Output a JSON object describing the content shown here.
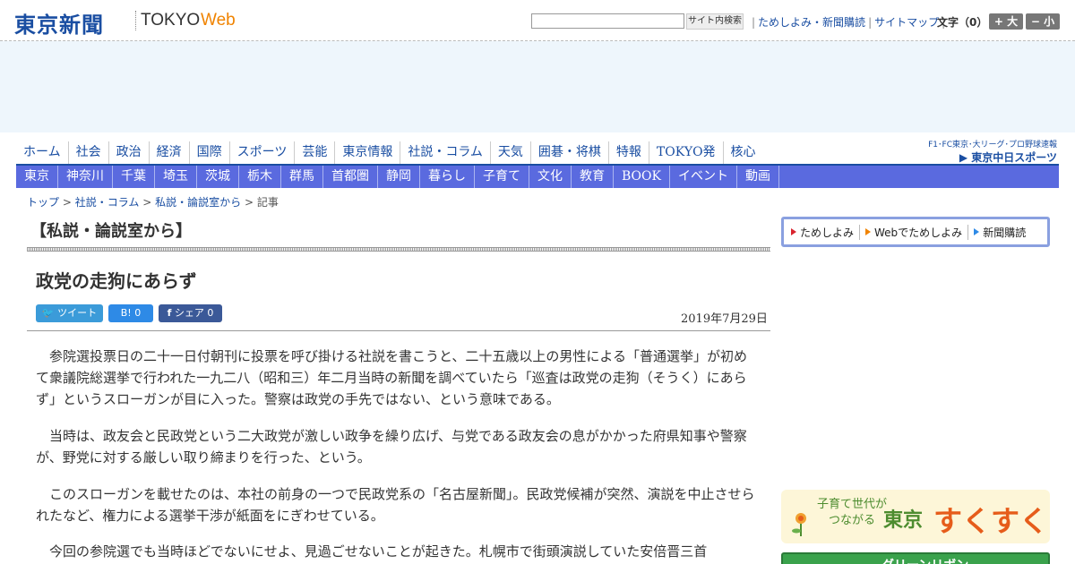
{
  "header": {
    "logo_jp": "東京新聞",
    "logo_tokyo": "TOKYO",
    "logo_web": "Web",
    "search_placeholder": "",
    "search_button": "サイト内検索",
    "links": [
      "ためしよみ・新聞購読",
      "サイトマップ"
    ],
    "fontsize_label": "文字（0）",
    "fontsize_plus": "+ 大",
    "fontsize_minus": "− 小"
  },
  "nav_primary": [
    "ホーム",
    "社会",
    "政治",
    "経済",
    "国際",
    "スポーツ",
    "芸能",
    "東京情報",
    "社説・コラム",
    "天気",
    "囲碁・将棋",
    "特報",
    "TOKYO発",
    "核心"
  ],
  "chunichi_banner": {
    "line1": "F1･FC東京･大リーグ･プロ野球速報",
    "line2": "▶ 東京中日スポーツ"
  },
  "nav_secondary": [
    "東京",
    "神奈川",
    "千葉",
    "埼玉",
    "茨城",
    "栃木",
    "群馬",
    "首都圏",
    "静岡",
    "暮らし",
    "子育て",
    "文化",
    "教育",
    "BOOK",
    "イベント",
    "動画"
  ],
  "breadcrumb": {
    "items": [
      "トップ",
      "社説・コラム",
      "私説・論説室から"
    ],
    "current": "記事",
    "separator": ">"
  },
  "section_title": "【私説・論説室から】",
  "article": {
    "title": "政党の走狗にあらず",
    "date": "2019年7月29日",
    "tweet_label": "ツイート",
    "hatena_label": "B! 0",
    "facebook_label": "シェア 0",
    "paragraphs": [
      "　参院選投票日の二十一日付朝刊に投票を呼び掛ける社説を書こうと、二十五歳以上の男性による「普通選挙」が初めて衆議院総選挙で行われた一九二八（昭和三）年二月当時の新聞を調べていたら「巡査は政党の走狗（そうく）にあらず」というスローガンが目に入った。警察は政党の手先ではない、という意味である。",
      "　当時は、政友会と民政党という二大政党が激しい政争を繰り広げ、与党である政友会の息がかかった府県知事や警察が、野党に対する厳しい取り締まりを行った、という。",
      "　このスローガンを載せたのは、本社の前身の一つで民政党系の「名古屋新聞」。民政党候補が突然、演説を中止させられたなど、権力による選挙干渉が紙面をにぎわせている。",
      "　今回の参院選でも当時ほどでないにせよ、見過ごせないことが起きた。札幌市で街頭演説していた安倍晋三首"
    ]
  },
  "sidebar": {
    "subscribe_options": [
      "ためしよみ",
      "Webでためしよみ",
      "新聞購読"
    ],
    "sukusuku": {
      "small_line1": "子育て世代が",
      "small_line2": "つながる",
      "tokyo": "東京",
      "main": "すくすく"
    },
    "green_banner": "グリーンリボン"
  }
}
